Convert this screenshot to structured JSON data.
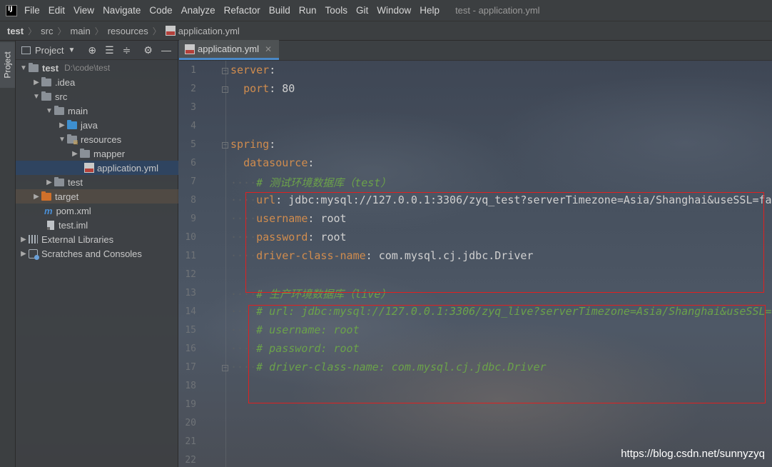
{
  "menubar": {
    "items": [
      "File",
      "Edit",
      "View",
      "Navigate",
      "Code",
      "Analyze",
      "Refactor",
      "Build",
      "Run",
      "Tools",
      "Git",
      "Window",
      "Help"
    ],
    "window_title": "test - application.yml"
  },
  "breadcrumbs": [
    "test",
    "src",
    "main",
    "resources",
    "application.yml"
  ],
  "tool_stripe": {
    "project_tab": "Project"
  },
  "project_panel": {
    "title": "Project",
    "tree": [
      {
        "label": "test",
        "extra": "D:\\code\\test"
      },
      {
        "label": ".idea"
      },
      {
        "label": "src"
      },
      {
        "label": "main"
      },
      {
        "label": "java"
      },
      {
        "label": "resources"
      },
      {
        "label": "mapper"
      },
      {
        "label": "application.yml"
      },
      {
        "label": "test"
      },
      {
        "label": "target"
      },
      {
        "label": "pom.xml"
      },
      {
        "label": "test.iml"
      },
      {
        "label": "External Libraries"
      },
      {
        "label": "Scratches and Consoles"
      }
    ]
  },
  "editor": {
    "tab_label": "application.yml",
    "line_numbers": [
      "1",
      "2",
      "3",
      "4",
      "5",
      "6",
      "7",
      "8",
      "9",
      "10",
      "11",
      "12",
      "13",
      "14",
      "15",
      "16",
      "17",
      "18",
      "19",
      "20",
      "21",
      "22"
    ],
    "lines": {
      "l1_key": "server",
      "l2_key": "port",
      "l2_val": " 80",
      "l5_key": "spring",
      "l6_key": "datasource",
      "l7": "# 测试环境数据库（test）",
      "l8_key": "url",
      "l8_val": " jdbc:mysql://127.0.0.1:3306/zyq_test?serverTimezone=Asia/Shanghai&useSSL=fa",
      "l9_key": "username",
      "l9_val": " root",
      "l10_key": "password",
      "l10_val": " root",
      "l11_key": "driver-class-name",
      "l11_val": " com.mysql.cj.jdbc.Driver",
      "l13": "# 生产环境数据库（live）",
      "l14": "# url: jdbc:mysql://127.0.0.1:3306/zyq_live?serverTimezone=Asia/Shanghai&useSSL=",
      "l15": "# username: root",
      "l16": "# password: root",
      "l17": "# driver-class-name: com.mysql.cj.jdbc.Driver"
    }
  },
  "watermark": "https://blog.csdn.net/sunnyzyq",
  "colors": {
    "key": "#d08c4e",
    "comment": "#6ba24a",
    "annotation_box": "#e02020",
    "selection": "#2f4460"
  }
}
